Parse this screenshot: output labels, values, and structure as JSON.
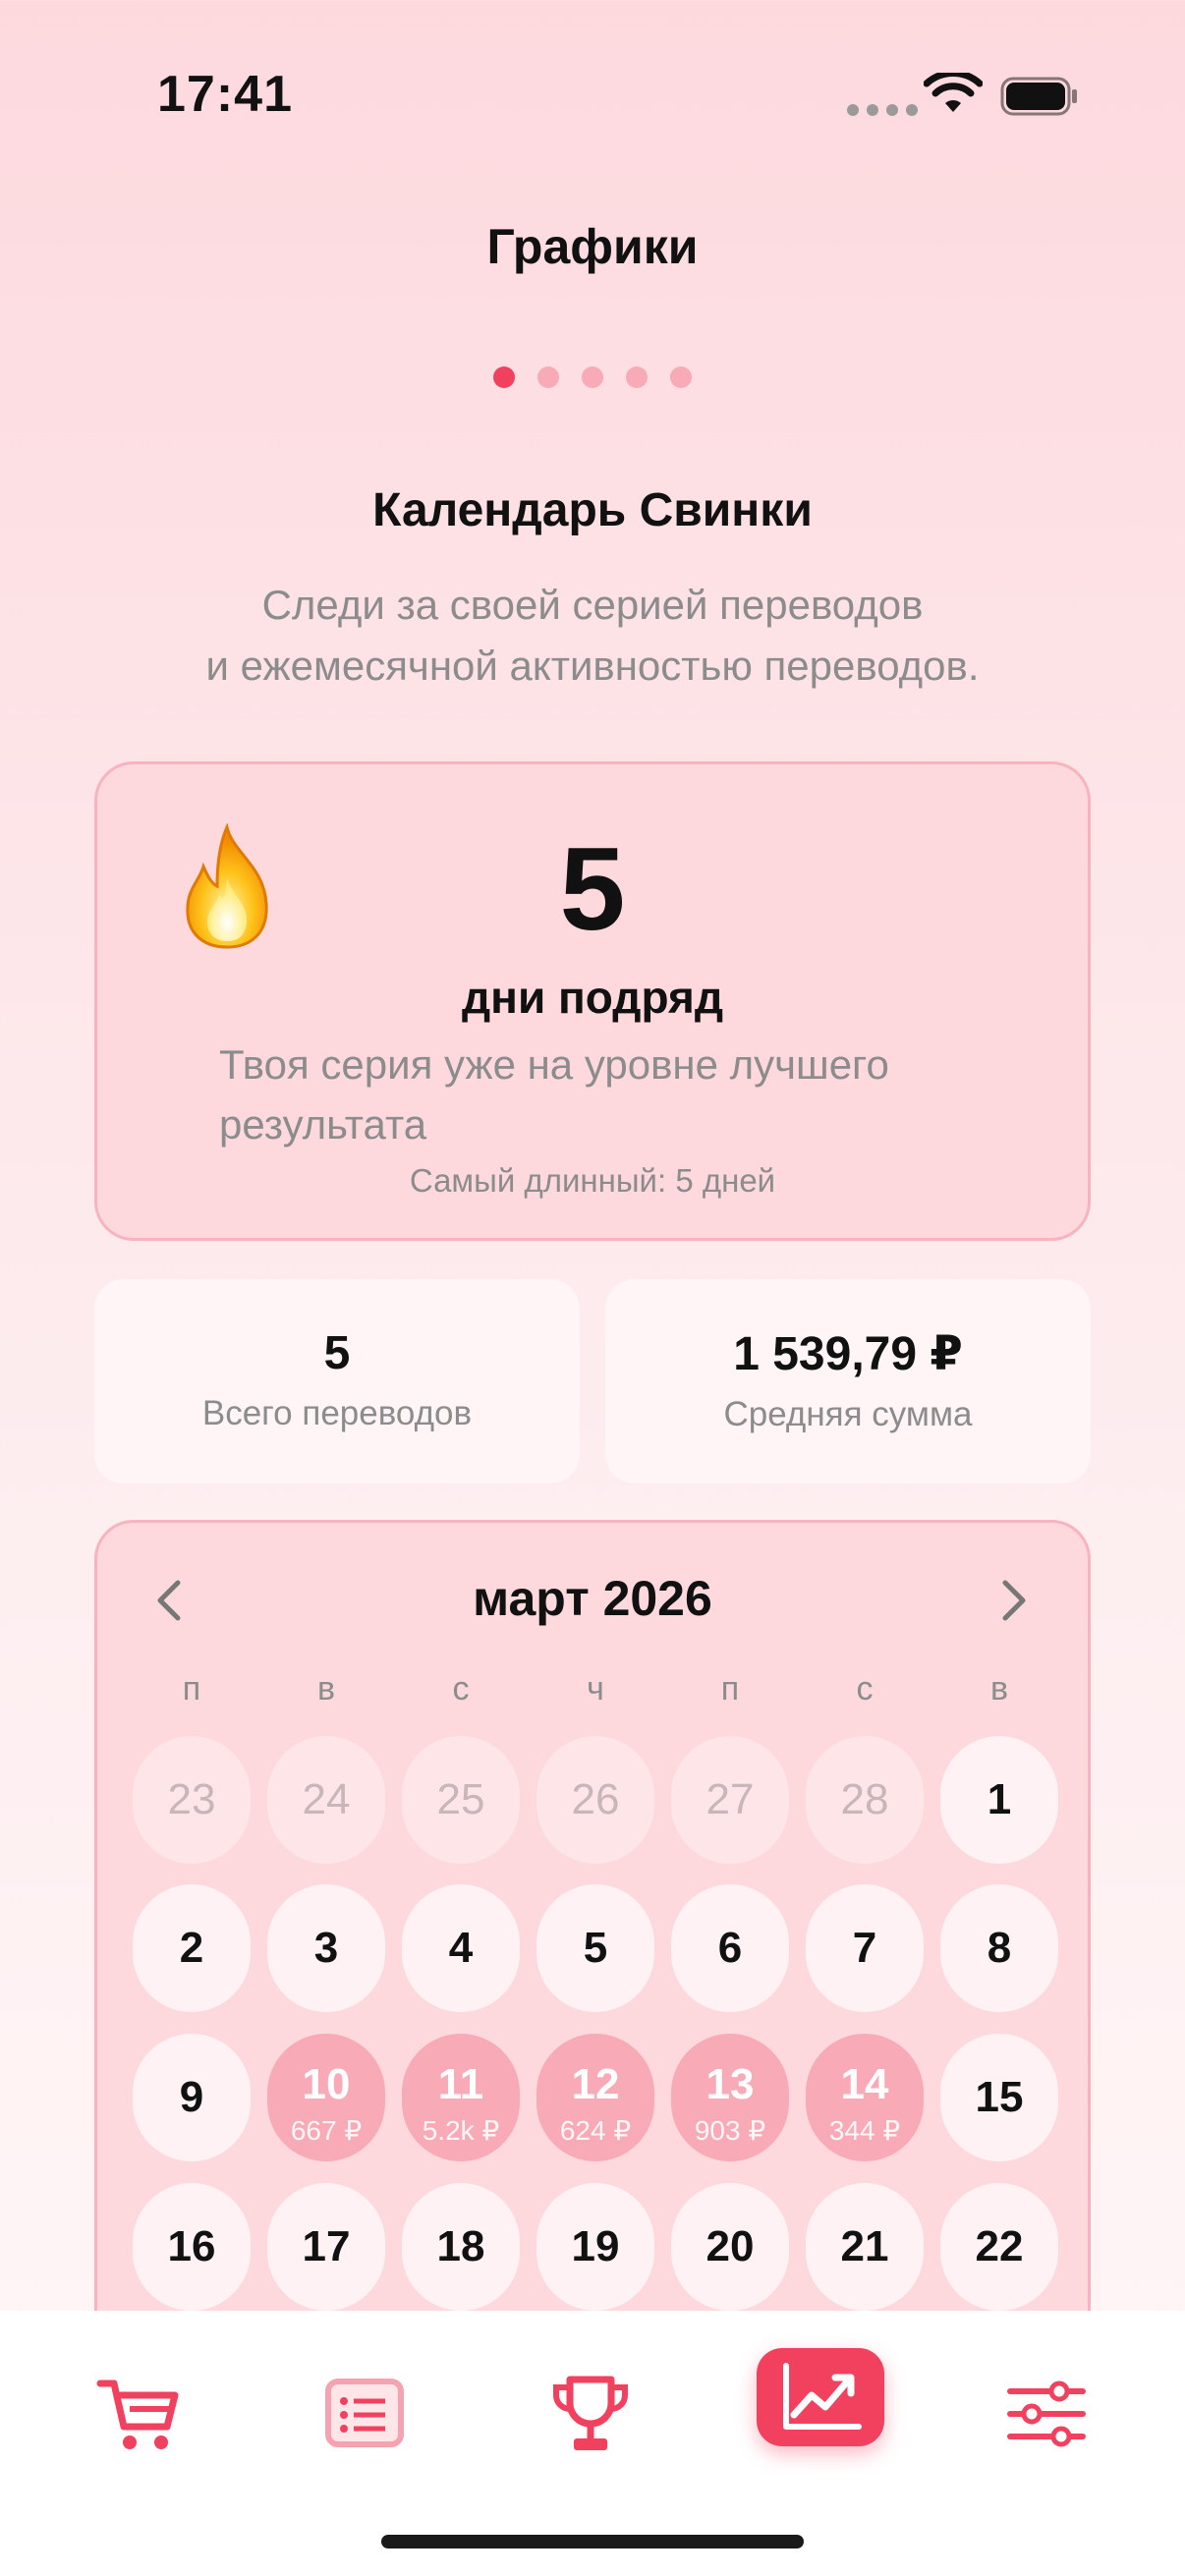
{
  "status_bar": {
    "time": "17:41"
  },
  "header": {
    "title": "Графики",
    "pager_count": 5,
    "pager_active": 0
  },
  "section": {
    "title": "Календарь Свинки",
    "subtitle_line1": "Следи за своей серией переводов",
    "subtitle_line2": "и ежемесячной активностью переводов."
  },
  "streak": {
    "icon": "fire-icon",
    "count": "5",
    "label": "дни подряд",
    "description_line1": "Твоя серия уже на уровне лучшего",
    "description_line2": "результата",
    "best": "Самый длинный: 5 дней"
  },
  "stats": {
    "total_value": "5",
    "total_label": "Всего переводов",
    "average_value": "1 539,79 ₽",
    "average_label": "Средняя сумма"
  },
  "calendar": {
    "month": "март 2026",
    "weekdays": [
      "п",
      "в",
      "с",
      "ч",
      "п",
      "с",
      "в"
    ],
    "days": [
      {
        "num": "23",
        "state": "faded"
      },
      {
        "num": "24",
        "state": "faded"
      },
      {
        "num": "25",
        "state": "faded"
      },
      {
        "num": "26",
        "state": "faded"
      },
      {
        "num": "27",
        "state": "faded"
      },
      {
        "num": "28",
        "state": "faded"
      },
      {
        "num": "1",
        "state": "normal"
      },
      {
        "num": "2",
        "state": "normal"
      },
      {
        "num": "3",
        "state": "normal"
      },
      {
        "num": "4",
        "state": "normal"
      },
      {
        "num": "5",
        "state": "normal"
      },
      {
        "num": "6",
        "state": "normal"
      },
      {
        "num": "7",
        "state": "normal"
      },
      {
        "num": "8",
        "state": "normal"
      },
      {
        "num": "9",
        "state": "normal"
      },
      {
        "num": "10",
        "state": "active",
        "amount": "667 ₽"
      },
      {
        "num": "11",
        "state": "active",
        "amount": "5.2k ₽"
      },
      {
        "num": "12",
        "state": "active",
        "amount": "624 ₽"
      },
      {
        "num": "13",
        "state": "active",
        "amount": "903 ₽"
      },
      {
        "num": "14",
        "state": "active",
        "amount": "344 ₽"
      },
      {
        "num": "15",
        "state": "normal"
      },
      {
        "num": "16",
        "state": "normal"
      },
      {
        "num": "17",
        "state": "normal"
      },
      {
        "num": "18",
        "state": "normal"
      },
      {
        "num": "19",
        "state": "normal"
      },
      {
        "num": "20",
        "state": "normal"
      },
      {
        "num": "21",
        "state": "normal"
      },
      {
        "num": "22",
        "state": "normal"
      }
    ]
  },
  "tabbar": {
    "tabs": [
      {
        "icon": "cart-icon"
      },
      {
        "icon": "list-icon"
      },
      {
        "icon": "trophy-icon"
      },
      {
        "icon": "chart-icon",
        "active": true
      },
      {
        "icon": "sliders-icon"
      }
    ]
  },
  "colors": {
    "accent": "#f2405f",
    "accent_light": "#f8aab7",
    "card_bg": "#fdd9de",
    "muted_text": "#8c8c8c"
  }
}
